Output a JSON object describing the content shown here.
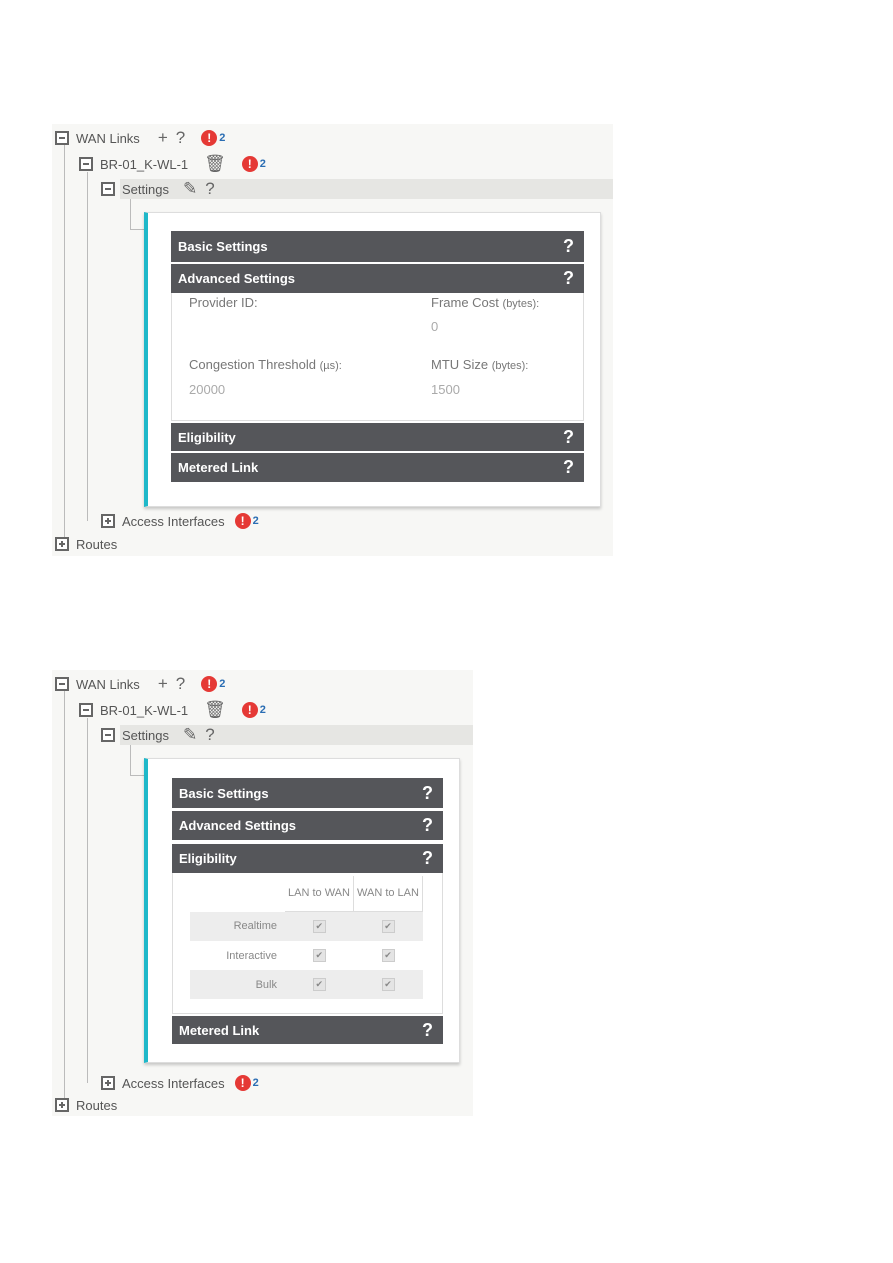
{
  "panels": [
    {
      "tree": {
        "wan_links": "WAN Links",
        "wan_alert_count": "2",
        "link_name": "BR-01_K-WL-1",
        "link_alert_count": "2",
        "settings": "Settings",
        "access_interfaces": "Access Interfaces",
        "access_alert_count": "2",
        "routes": "Routes"
      },
      "sections": {
        "basic": "Basic Settings",
        "advanced": "Advanced Settings",
        "eligibility": "Eligibility",
        "metered": "Metered Link",
        "help": "?"
      },
      "advanced": {
        "provider_id_label": "Provider ID:",
        "frame_cost_label": "Frame Cost",
        "frame_cost_unit": "(bytes):",
        "frame_cost_value": "0",
        "congestion_label": "Congestion Threshold",
        "congestion_unit": "(µs):",
        "congestion_value": "20000",
        "mtu_label": "MTU Size",
        "mtu_unit": "(bytes):",
        "mtu_value": "1500"
      }
    },
    {
      "tree": {
        "wan_links": "WAN Links",
        "wan_alert_count": "2",
        "link_name": "BR-01_K-WL-1",
        "link_alert_count": "2",
        "settings": "Settings",
        "access_interfaces": "Access Interfaces",
        "access_alert_count": "2",
        "routes": "Routes"
      },
      "sections": {
        "basic": "Basic Settings",
        "advanced": "Advanced Settings",
        "eligibility": "Eligibility",
        "metered": "Metered Link",
        "help": "?"
      },
      "eligibility": {
        "columns": [
          "LAN to WAN",
          "WAN to LAN"
        ],
        "rows": [
          {
            "label": "Realtime",
            "lan_to_wan": true,
            "wan_to_lan": true
          },
          {
            "label": "Interactive",
            "lan_to_wan": true,
            "wan_to_lan": true
          },
          {
            "label": "Bulk",
            "lan_to_wan": true,
            "wan_to_lan": true
          }
        ]
      }
    }
  ],
  "icons": {
    "add": "plus-icon",
    "help": "question-icon",
    "alert": "exclamation-icon",
    "delete": "trash-icon",
    "edit": "pencil-icon"
  },
  "colors": {
    "accent": "#1fb8c9",
    "header": "#55565a",
    "alert": "#e53935",
    "count": "#2a6db3"
  }
}
